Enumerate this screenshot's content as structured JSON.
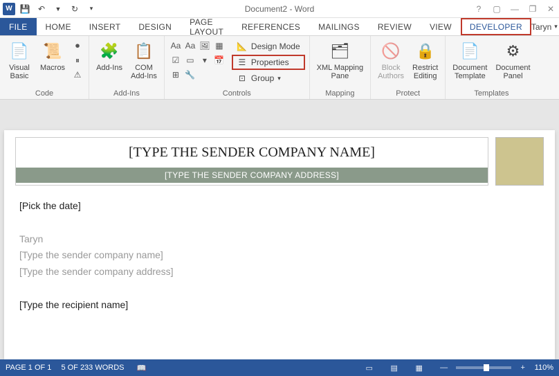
{
  "titlebar": {
    "app_icon_letter": "W",
    "title": "Document2 - Word",
    "qat": {
      "save": "💾",
      "undo": "↶",
      "redo": "↻",
      "customize": "▾"
    },
    "win": {
      "help": "?",
      "ribbon_opts": "▢",
      "min": "—",
      "restore": "❐",
      "close": "✕"
    }
  },
  "tabs": {
    "file": "FILE",
    "home": "HOME",
    "insert": "INSERT",
    "design": "DESIGN",
    "page_layout": "PAGE LAYOUT",
    "references": "REFERENCES",
    "mailings": "MAILINGS",
    "review": "REVIEW",
    "view": "VIEW",
    "developer": "DEVELOPER",
    "user": "Taryn"
  },
  "ribbon": {
    "code": {
      "visual_basic": "Visual\nBasic",
      "macros": "Macros",
      "group": "Code"
    },
    "addins": {
      "addins": "Add-Ins",
      "com": "COM\nAdd-Ins",
      "group": "Add-Ins"
    },
    "controls": {
      "design_mode": "Design Mode",
      "properties": "Properties",
      "group_btn": "Group",
      "group": "Controls"
    },
    "mapping": {
      "xml": "XML Mapping\nPane",
      "group": "Mapping"
    },
    "protect": {
      "block": "Block\nAuthors",
      "restrict": "Restrict\nEditing",
      "group": "Protect"
    },
    "templates": {
      "doc_template": "Document\nTemplate",
      "doc_panel": "Document\nPanel",
      "group": "Templates"
    }
  },
  "document": {
    "company_name": "[TYPE THE SENDER COMPANY NAME]",
    "company_address": "[TYPE THE SENDER COMPANY ADDRESS]",
    "pick_date": "[Pick the date]",
    "sender_name": "Taryn",
    "sender_company_ph": "[Type the sender company name]",
    "sender_address_ph": "[Type the sender company address]",
    "recipient_name": "[Type the recipient name]"
  },
  "status": {
    "page": "PAGE 1 OF 1",
    "words": "5 OF 233 WORDS",
    "zoom": "110%"
  }
}
